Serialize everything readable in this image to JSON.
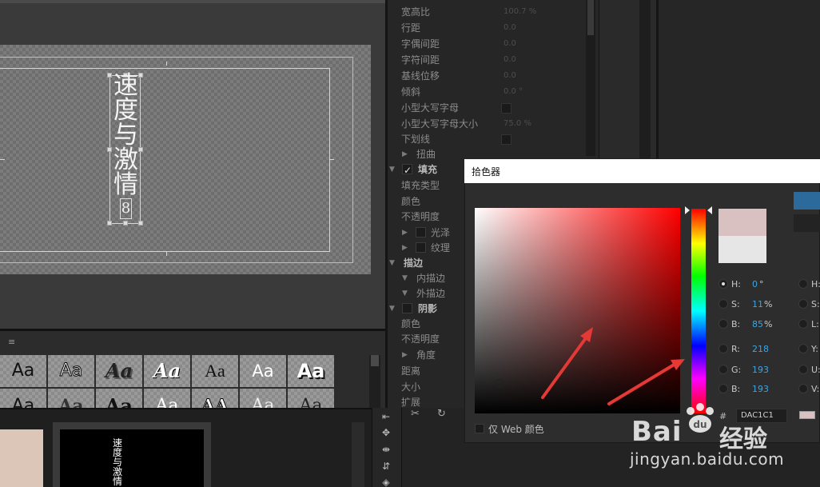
{
  "canvas": {
    "title_text": "速度与激情",
    "cursor_char": "8"
  },
  "properties": {
    "rows": [
      {
        "label": "宽高比",
        "value": "100.7 %"
      },
      {
        "label": "行距",
        "value": "0.0"
      },
      {
        "label": "字偶间距",
        "value": "0.0"
      },
      {
        "label": "字符间距",
        "value": "0.0"
      },
      {
        "label": "基线位移",
        "value": "0.0"
      },
      {
        "label": "倾斜",
        "value": "0.0 °"
      },
      {
        "label": "小型大写字母",
        "value": ""
      },
      {
        "label": "小型大写字母大小",
        "value": "75.0 %"
      },
      {
        "label": "下划线",
        "value": ""
      }
    ],
    "distort_label": "扭曲",
    "fill_section": "填充",
    "fill_type": "填充类型",
    "color": "颜色",
    "opacity": "不透明度",
    "sheen": "光泽",
    "texture": "纹理",
    "stroke_section": "描边",
    "inner_stroke": "内描边",
    "outer_stroke": "外描边",
    "shadow_section": "阴影",
    "shadow_color": "颜色",
    "shadow_opacity": "不透明度",
    "angle": "角度",
    "distance": "距离",
    "size": "大小",
    "spread": "扩展"
  },
  "styles": {
    "menu_icon": "≡",
    "row1": [
      "Aa",
      "Aa",
      "Aa",
      "Aa",
      "Aa",
      "Aa",
      "Aa"
    ],
    "row2": [
      "Aa",
      "Aa",
      "Aa",
      "Aa",
      "AA",
      "Aa",
      "Aa"
    ]
  },
  "timeline": {
    "clip_text": "速度与激情"
  },
  "color_picker": {
    "title": "拾色器",
    "selected_color": "#DAC1C1",
    "previous_color": "#E6E6E6",
    "hsb": [
      {
        "label": "H:",
        "value": "0",
        "unit": "°"
      },
      {
        "label": "S:",
        "value": "11",
        "unit": "%"
      },
      {
        "label": "B:",
        "value": "85",
        "unit": "%"
      }
    ],
    "rgb": [
      {
        "label": "R:",
        "value": "218"
      },
      {
        "label": "G:",
        "value": "193"
      },
      {
        "label": "B:",
        "value": "193"
      }
    ],
    "hsl_labels": [
      "H:",
      "S:",
      "L:"
    ],
    "yuv_labels": [
      "Y:",
      "U:",
      "V:"
    ],
    "hex_prefix": "#",
    "hex_value": "DAC1C1",
    "web_only_label": "仅 Web 颜色"
  },
  "watermark": {
    "brand": "Bai",
    "brand_cn": "经验",
    "url": "jingyan.baidu.com"
  }
}
